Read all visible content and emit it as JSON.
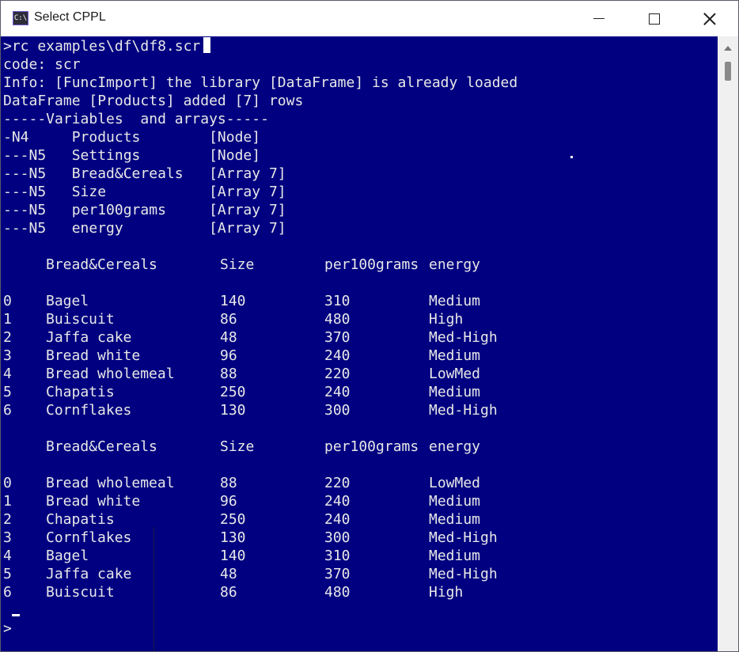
{
  "window": {
    "title": "Select CPPL",
    "icon_label": "C:\\",
    "colors": {
      "console_bg": "#000080",
      "console_text": "#e8e8e8",
      "titlebar_bg": "#ffffff"
    }
  },
  "console": {
    "prompt_line": ">rc examples\\df\\df8.scr",
    "lines": [
      "code: scr",
      "Info: [FuncImport] the library [DataFrame] is already loaded",
      "DataFrame [Products] added [7] rows",
      "-----Variables  and arrays-----",
      "-N4     Products        [Node]",
      "---N5   Settings        [Node]",
      "---N5   Bread&Cereals   [Array 7]",
      "---N5   Size            [Array 7]",
      "---N5   per100grams     [Array 7]",
      "---N5   energy          [Array 7]"
    ],
    "table1": {
      "headers": [
        "",
        "Bread&Cereals",
        "Size",
        "per100grams",
        "energy"
      ],
      "rows": [
        [
          "0",
          "Bagel",
          "140",
          "310",
          "Medium"
        ],
        [
          "1",
          "Buiscuit",
          "86",
          "480",
          "High"
        ],
        [
          "2",
          "Jaffa cake",
          "48",
          "370",
          "Med-High"
        ],
        [
          "3",
          "Bread white",
          "96",
          "240",
          "Medium"
        ],
        [
          "4",
          "Bread wholemeal",
          "88",
          "220",
          "LowMed"
        ],
        [
          "5",
          "Chapatis",
          "250",
          "240",
          "Medium"
        ],
        [
          "6",
          "Cornflakes",
          "130",
          "300",
          "Med-High"
        ]
      ]
    },
    "table2": {
      "headers": [
        "",
        "Bread&Cereals",
        "Size",
        "per100grams",
        "energy"
      ],
      "rows": [
        [
          "0",
          "Bread wholemeal",
          "88",
          "220",
          "LowMed"
        ],
        [
          "1",
          "Bread white",
          "96",
          "240",
          "Medium"
        ],
        [
          "2",
          "Chapatis",
          "250",
          "240",
          "Medium"
        ],
        [
          "3",
          "Cornflakes",
          "130",
          "300",
          "Med-High"
        ],
        [
          "4",
          "Bagel",
          "140",
          "310",
          "Medium"
        ],
        [
          "5",
          "Jaffa cake",
          "48",
          "370",
          "Med-High"
        ],
        [
          "6",
          "Buiscuit",
          "86",
          "480",
          "High"
        ]
      ]
    },
    "final_prompt": ">"
  }
}
